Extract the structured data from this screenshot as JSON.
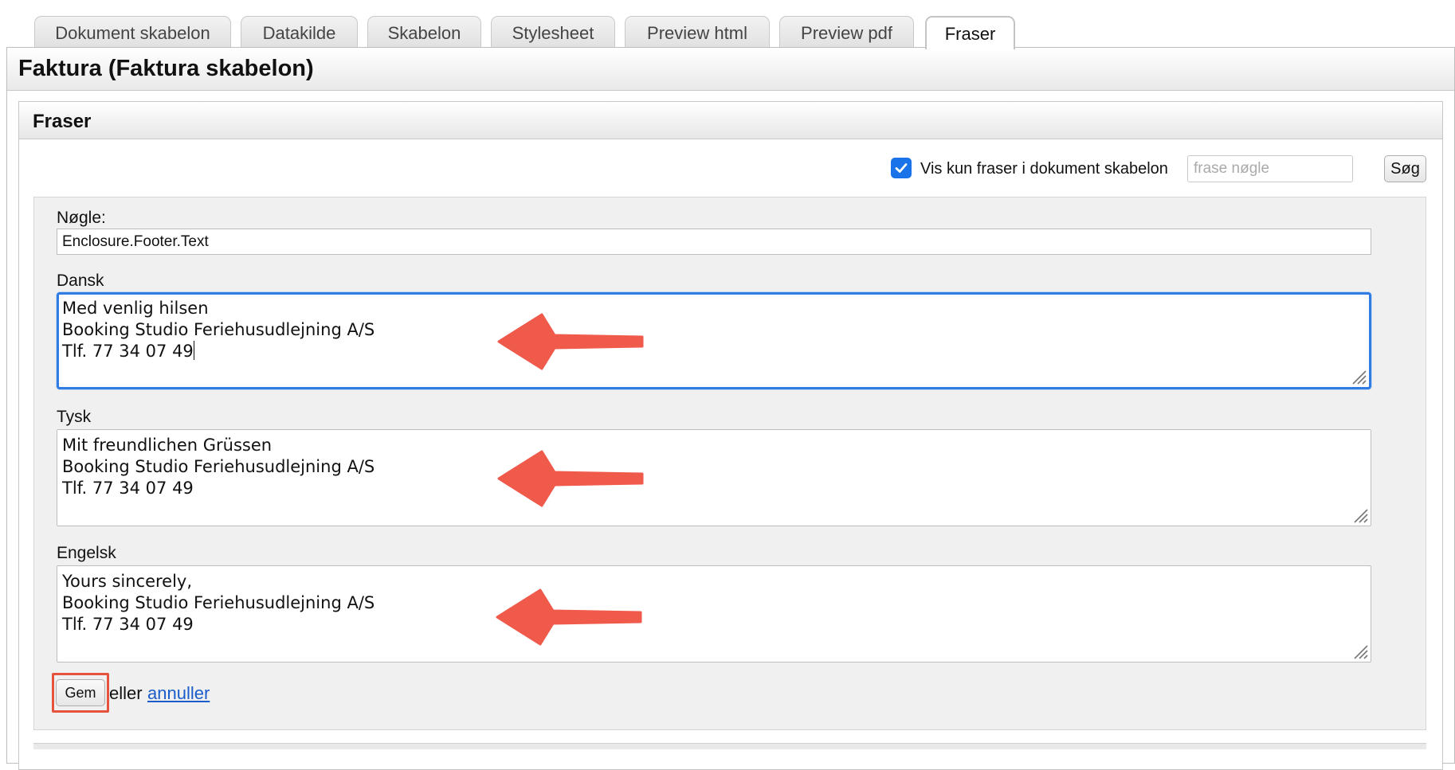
{
  "tabs": [
    {
      "label": "Dokument skabelon",
      "active": false
    },
    {
      "label": "Datakilde",
      "active": false
    },
    {
      "label": "Skabelon",
      "active": false
    },
    {
      "label": "Stylesheet",
      "active": false
    },
    {
      "label": "Preview html",
      "active": false
    },
    {
      "label": "Preview pdf",
      "active": false
    },
    {
      "label": "Fraser",
      "active": true
    }
  ],
  "page": {
    "title": "Faktura (Faktura skabelon)"
  },
  "section": {
    "title": "Fraser"
  },
  "filter": {
    "checkbox_label": "Vis kun fraser i dokument skabelon",
    "checked": true,
    "search_placeholder": "frase nøgle",
    "search_button": "Søg"
  },
  "form": {
    "key_label": "Nøgle:",
    "key_value": "Enclosure.Footer.Text",
    "languages": [
      {
        "label": "Dansk",
        "text": "Med venlig hilsen\nBooking Studio Feriehusudlejning A/S\nTlf. 77 34 07 49",
        "focused": true
      },
      {
        "label": "Tysk",
        "text": "Mit freundlichen Grüssen\nBooking Studio Feriehusudlejning A/S\nTlf. 77 34 07 49",
        "focused": false
      },
      {
        "label": "Engelsk",
        "text": "Yours sincerely,\nBooking Studio Feriehusudlejning A/S\nTlf. 77 34 07 49",
        "focused": false
      }
    ],
    "save_button": "Gem",
    "or_text": "eller",
    "cancel_link": "annuller"
  },
  "colors": {
    "accent": "#1a73e8",
    "annotation_arrow": "#f05a4b",
    "link": "#1a5cc9"
  }
}
